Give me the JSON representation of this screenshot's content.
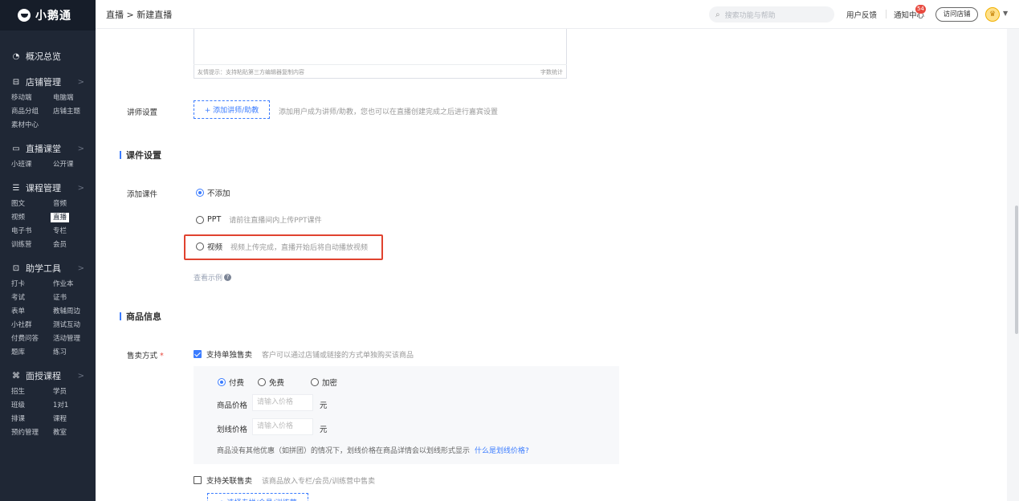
{
  "app": {
    "logo_text": "小鹅通"
  },
  "sidebar": {
    "groups": [
      {
        "icon": "dashboard-icon",
        "glyph": "◔",
        "label": "概况总览",
        "items": []
      },
      {
        "icon": "shop-icon",
        "glyph": "⊟",
        "label": "店铺管理",
        "items": [
          "移动端",
          "电脑端",
          "商品分组",
          "店铺主题",
          "素材中心"
        ]
      },
      {
        "icon": "live-icon",
        "glyph": "▭",
        "label": "直播课堂",
        "items": [
          "小班课",
          "公开课"
        ]
      },
      {
        "icon": "course-icon",
        "glyph": "☰",
        "label": "课程管理",
        "items": [
          "图文",
          "音频",
          "视频",
          "直播",
          "电子书",
          "专栏",
          "训练营",
          "会员"
        ]
      },
      {
        "icon": "tools-icon",
        "glyph": "⊡",
        "label": "助学工具",
        "items": [
          "打卡",
          "作业本",
          "考试",
          "证书",
          "表单",
          "教辅周边",
          "小社群",
          "测试互动",
          "付费问答",
          "活动管理",
          "题库",
          "练习"
        ]
      },
      {
        "icon": "offline-icon",
        "glyph": "⌘",
        "label": "面授课程",
        "items": [
          "招生",
          "学员",
          "班级",
          "1对1",
          "排课",
          "课程",
          "预约管理",
          "教室"
        ]
      }
    ],
    "active_item": "直播"
  },
  "topbar": {
    "breadcrumb": "直播 > 新建直播",
    "search_placeholder": "搜索功能与帮助",
    "feedback": "用户反馈",
    "notify": "通知中心",
    "notify_badge": "54",
    "visit_shop": "访问店铺"
  },
  "editor": {
    "tip": "友情提示：支持粘贴第三方编辑器复制内容",
    "word_count": "字数统计"
  },
  "teacher": {
    "label": "讲师设置",
    "button": "+ 添加讲师/助教",
    "hint": "添加用户成为讲师/助教，您也可以在直播创建完成之后进行嘉宾设置"
  },
  "courseware": {
    "section_title": "课件设置",
    "label": "添加课件",
    "options": [
      {
        "label": "不添加",
        "hint": "",
        "selected": true
      },
      {
        "label": "PPT",
        "hint": "请前往直播间内上传PPT课件",
        "selected": false
      },
      {
        "label": "视频",
        "hint": "视频上传完成，直播开始后将自动播放视频",
        "selected": false
      }
    ],
    "example_link": "查看示例"
  },
  "product": {
    "section_title": "商品信息",
    "sale_label": "售卖方式",
    "required_mark": "*",
    "single_sale": {
      "label": "支持单独售卖",
      "hint": "客户可以通过店铺或链接的方式单独购买该商品",
      "checked": true
    },
    "pay_options": [
      {
        "label": "付费",
        "selected": true
      },
      {
        "label": "免费",
        "selected": false
      },
      {
        "label": "加密",
        "selected": false
      }
    ],
    "price_label": "商品价格",
    "price_placeholder": "请输入价格",
    "strike_label": "划线价格",
    "strike_placeholder": "请输入价格",
    "unit": "元",
    "strike_note": "商品没有其他优惠（如拼团）的情况下，划线价格在商品详情会以划线形式显示",
    "strike_link": "什么是划线价格?",
    "bundle_sale": {
      "label": "支持关联售卖",
      "hint": "该商品放入专栏/会员/训练营中售卖",
      "checked": false
    },
    "bundle_button": "+ 选择专栏/会员/训练营"
  }
}
